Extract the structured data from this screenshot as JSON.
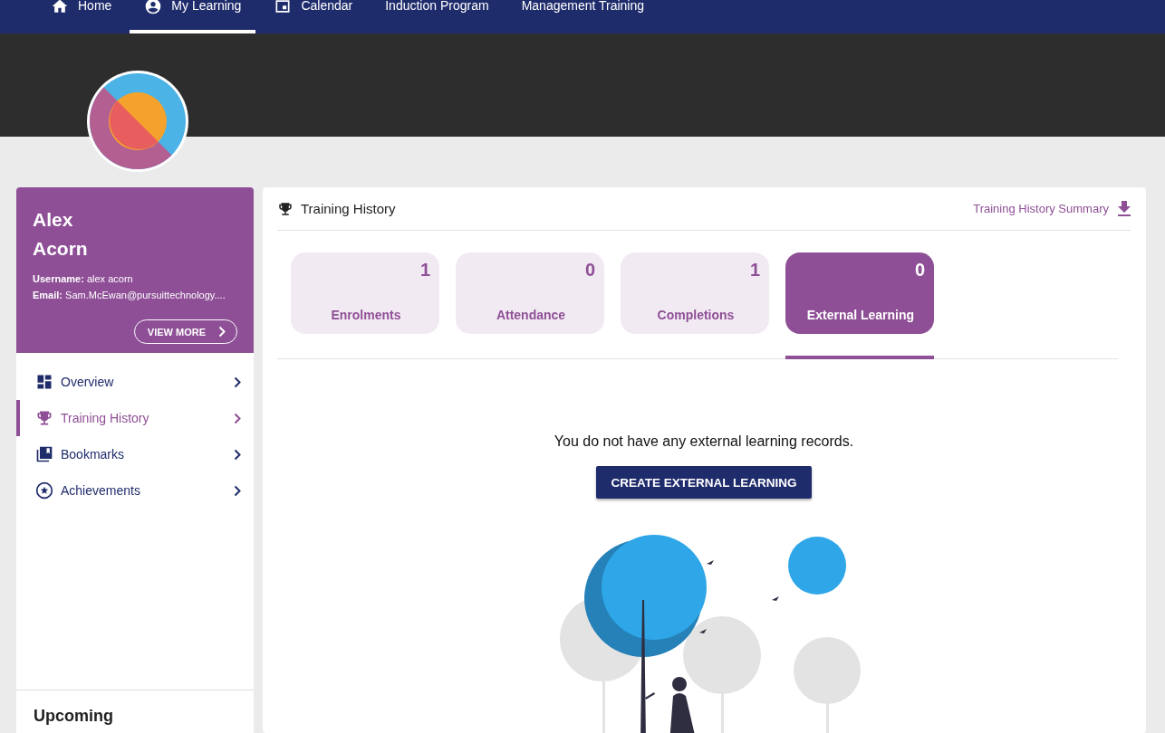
{
  "nav": {
    "items": [
      {
        "label": "Home",
        "selected": false
      },
      {
        "label": "My Learning",
        "selected": true
      },
      {
        "label": "Calendar",
        "selected": false
      },
      {
        "label": "Induction Program",
        "selected": false
      },
      {
        "label": "Management Training",
        "selected": false
      }
    ]
  },
  "profile": {
    "first_name": "Alex",
    "last_name": "Acorn",
    "username_label": "Username:",
    "username": "alex acorn",
    "email_label": "Email:",
    "email": "Sam.McEwan@pursuittechnology....",
    "button": "VIEW MORE"
  },
  "sidebar": {
    "items": [
      {
        "label": "Overview",
        "selected": false
      },
      {
        "label": "Training History",
        "selected": true
      },
      {
        "label": "Bookmarks",
        "selected": false
      },
      {
        "label": "Achievements",
        "selected": false
      }
    ],
    "section_title": "Upcoming"
  },
  "panel": {
    "title": "Training History",
    "summary_link": "Training History Summary",
    "stats": [
      {
        "value": "1",
        "label": "Enrolments",
        "selected": false
      },
      {
        "value": "0",
        "label": "Attendance",
        "selected": false
      },
      {
        "value": "1",
        "label": "Completions",
        "selected": false
      },
      {
        "value": "0",
        "label": "External Learning",
        "selected": true
      }
    ],
    "empty_message": "You do not have any external learning records.",
    "create_button": "CREATE EXTERNAL LEARNING"
  }
}
